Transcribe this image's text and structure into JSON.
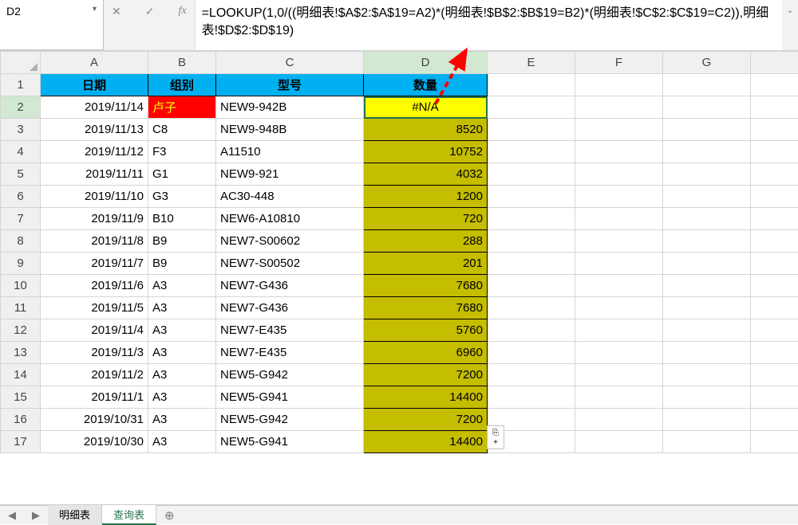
{
  "nameBox": {
    "value": "D2"
  },
  "formulaBar": {
    "value": "=LOOKUP(1,0/((明细表!$A$2:$A$19=A2)*(明细表!$B$2:$B$19=B2)*(明细表!$C$2:$C$19=C2)),明细表!$D$2:$D$19)"
  },
  "columns": [
    "A",
    "B",
    "C",
    "D",
    "E",
    "F",
    "G"
  ],
  "headers": {
    "a": "日期",
    "b": "组别",
    "c": "型号",
    "d": "数量"
  },
  "rows": [
    {
      "n": 1
    },
    {
      "n": 2,
      "a": "2019/11/14",
      "b": "卢子",
      "c": "NEW9-942B",
      "d": "#N/A",
      "red": true,
      "yellow": true
    },
    {
      "n": 3,
      "a": "2019/11/13",
      "b": "C8",
      "c": "NEW9-948B",
      "d": "8520"
    },
    {
      "n": 4,
      "a": "2019/11/12",
      "b": "F3",
      "c": "A11510",
      "d": "10752"
    },
    {
      "n": 5,
      "a": "2019/11/11",
      "b": "G1",
      "c": "NEW9-921",
      "d": "4032"
    },
    {
      "n": 6,
      "a": "2019/11/10",
      "b": "G3",
      "c": "AC30-448",
      "d": "1200"
    },
    {
      "n": 7,
      "a": "2019/11/9",
      "b": "B10",
      "c": "NEW6-A10810",
      "d": "720"
    },
    {
      "n": 8,
      "a": "2019/11/8",
      "b": "B9",
      "c": "NEW7-S00602",
      "d": "288"
    },
    {
      "n": 9,
      "a": "2019/11/7",
      "b": "B9",
      "c": "NEW7-S00502",
      "d": "201"
    },
    {
      "n": 10,
      "a": "2019/11/6",
      "b": "A3",
      "c": "NEW7-G436",
      "d": "7680"
    },
    {
      "n": 11,
      "a": "2019/11/5",
      "b": "A3",
      "c": "NEW7-G436",
      "d": "7680"
    },
    {
      "n": 12,
      "a": "2019/11/4",
      "b": "A3",
      "c": "NEW7-E435",
      "d": "5760"
    },
    {
      "n": 13,
      "a": "2019/11/3",
      "b": "A3",
      "c": "NEW7-E435",
      "d": "6960"
    },
    {
      "n": 14,
      "a": "2019/11/2",
      "b": "A3",
      "c": "NEW5-G942",
      "d": "7200"
    },
    {
      "n": 15,
      "a": "2019/11/1",
      "b": "A3",
      "c": "NEW5-G941",
      "d": "14400"
    },
    {
      "n": 16,
      "a": "2019/10/31",
      "b": "A3",
      "c": "NEW5-G942",
      "d": "7200"
    },
    {
      "n": 17,
      "a": "2019/10/30",
      "b": "A3",
      "c": "NEW5-G941",
      "d": "14400"
    }
  ],
  "activeCell": {
    "row": 2,
    "col": "D"
  },
  "sheets": {
    "list": [
      {
        "name": "明细表",
        "active": false
      },
      {
        "name": "查询表",
        "active": true
      }
    ]
  },
  "icons": {
    "cancel": "✕",
    "confirm": "✓",
    "fx": "fx",
    "dropdown": "▾",
    "expand": "⌄",
    "navLeft": "◀",
    "navRight": "▶",
    "addSheet": "⊕"
  }
}
